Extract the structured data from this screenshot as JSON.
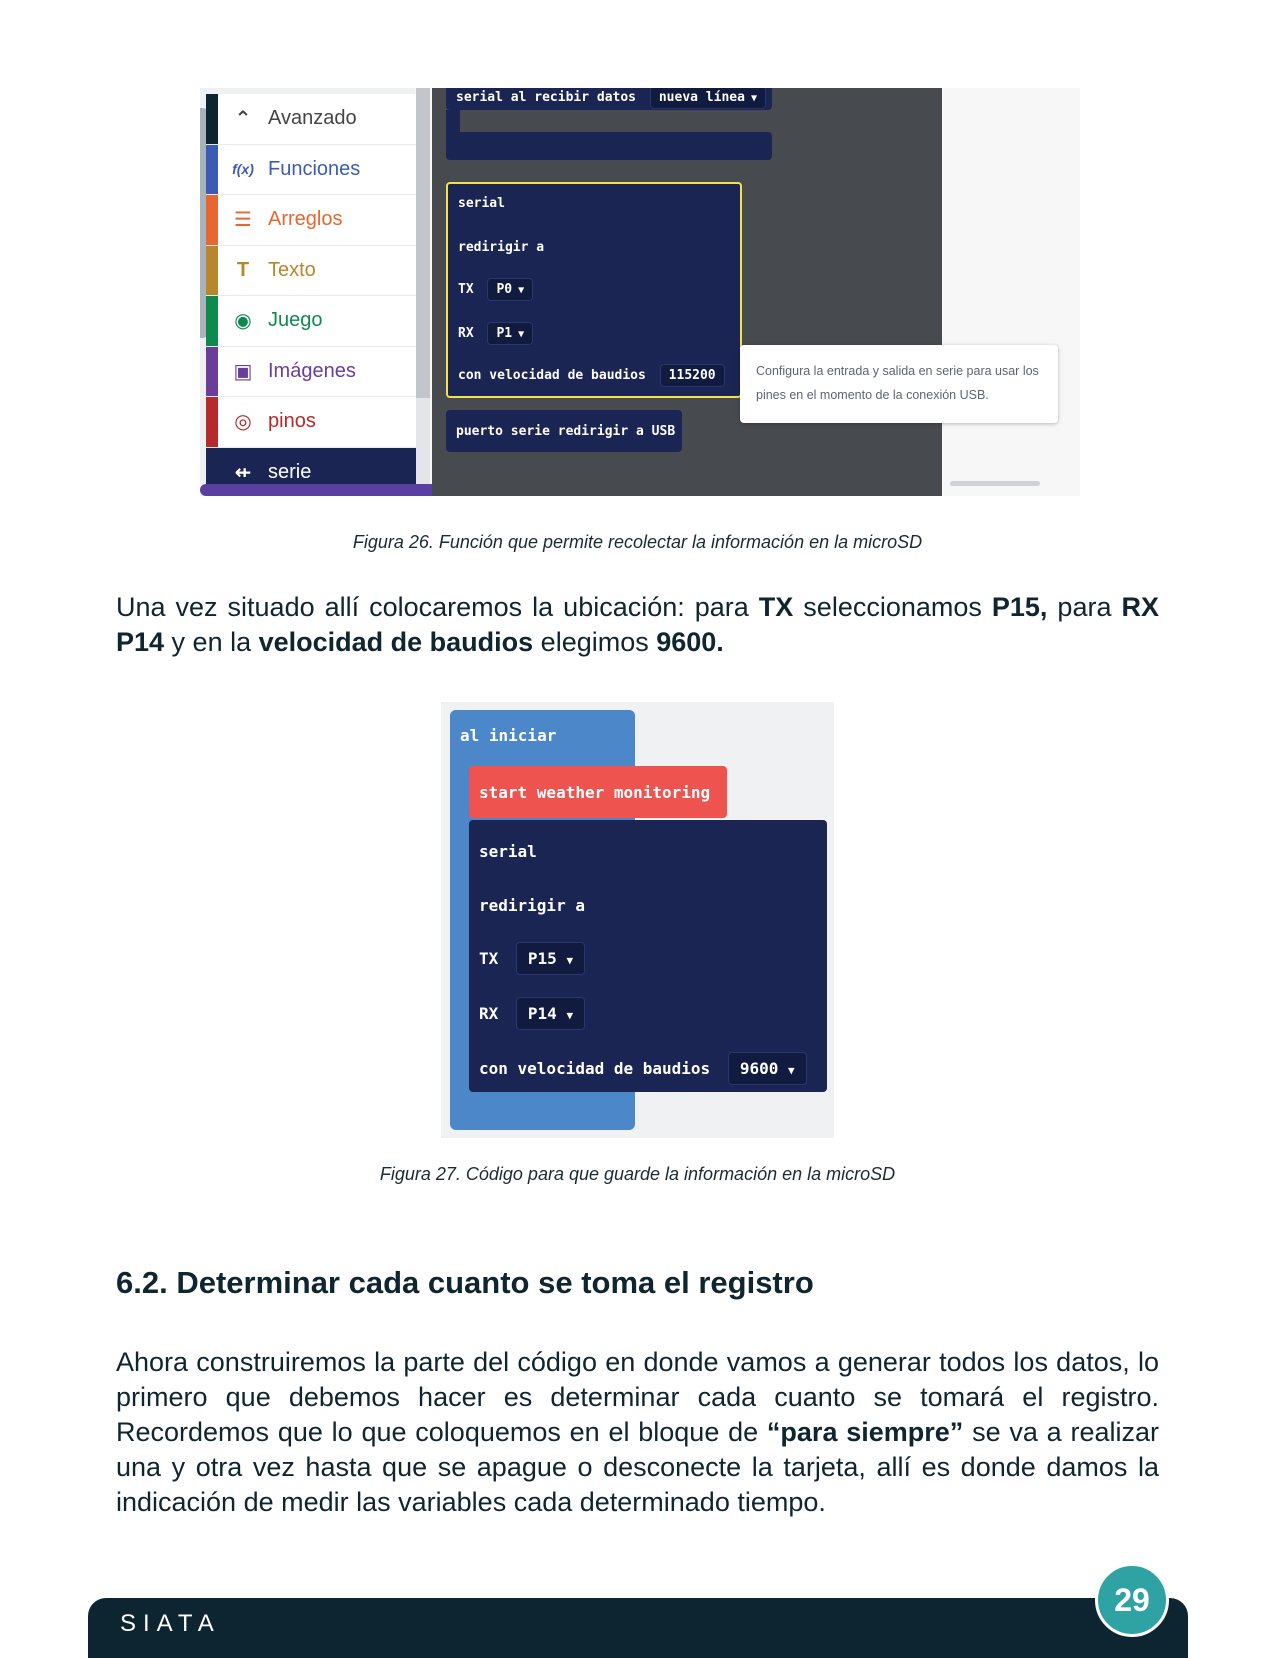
{
  "figure26": {
    "categories": [
      {
        "label": "Avanzado",
        "icon": "chevron-up-icon",
        "glyph": "⌃",
        "color": "#444444",
        "bar": "#0d2530"
      },
      {
        "label": "Funciones",
        "icon": "function-icon",
        "glyph": "f(x)",
        "color": "#3b5bb5",
        "bar": "#3b5bb5"
      },
      {
        "label": "Arreglos",
        "icon": "list-icon",
        "glyph": "☰",
        "color": "#e8662f",
        "bar": "#e8662f"
      },
      {
        "label": "Texto",
        "icon": "text-icon",
        "glyph": "T",
        "color": "#b8862c",
        "bar": "#b8862c"
      },
      {
        "label": "Juego",
        "icon": "gamepad-icon",
        "glyph": "◉",
        "color": "#0f8a4f",
        "bar": "#0f8a4f"
      },
      {
        "label": "Imágenes",
        "icon": "image-icon",
        "glyph": "▣",
        "color": "#6a3d9a",
        "bar": "#6a3d9a"
      },
      {
        "label": "pinos",
        "icon": "target-icon",
        "glyph": "◎",
        "color": "#b52a2a",
        "bar": "#b52a2a"
      },
      {
        "label": "serie",
        "icon": "usb-icon",
        "glyph": "⇷",
        "color": "#ffffff",
        "bar": "#1a2553"
      }
    ],
    "block_top": "serial al recibir datos",
    "block_top_dropdown": "nueva línea",
    "serial_label": "serial",
    "redirect_label": "redirigir a",
    "tx_label": "TX",
    "tx_value": "P0",
    "rx_label": "RX",
    "rx_value": "P1",
    "baud_label": "con velocidad de baudios",
    "baud_value": "115200",
    "usb_block": "puerto serie redirigir a USB",
    "tooltip": "Configura la entrada y salida en serie para usar los pines en el momento de la conexión USB."
  },
  "caption26": "Figura 26. Función que permite recolectar la información en la microSD",
  "paragraph1": {
    "t1": "Una vez situado allí colocaremos la ubicación: para ",
    "b1": "TX",
    "t2": " seleccionamos ",
    "b2": "P15,",
    "t3": " para ",
    "b3": "RX P14",
    "t4": " y en la ",
    "b4": "velocidad de baudios",
    "t5": " elegimos ",
    "b5": "9600."
  },
  "figure27": {
    "on_start": "al iniciar",
    "weather": "start weather monitoring",
    "serial_label": "serial",
    "redirect_label": "redirigir a",
    "tx_label": "TX",
    "tx_value": "P15",
    "rx_label": "RX",
    "rx_value": "P14",
    "baud_label": "con velocidad de baudios",
    "baud_value": "9600"
  },
  "caption27": "Figura 27. Código para que guarde la información en la microSD",
  "section_heading": "6.2. Determinar cada cuanto se toma el registro",
  "paragraph2": {
    "t1": "Ahora construiremos la parte del código en donde vamos a generar todos los datos, lo primero que debemos hacer es determinar cada cuanto se tomará el registro. Recordemos que lo que coloquemos en el bloque de ",
    "b1": "“para siempre”",
    "t2": " se va a realizar una y otra vez hasta que se apague o desconecte la tarjeta, allí es donde damos la indicación de medir las variables cada determinado tiempo."
  },
  "footer": {
    "brand": "SIATA",
    "page": "29"
  },
  "colors": {
    "footer": "#0d2530",
    "page_badge": "#2fa3a3",
    "block_navy": "#1a2553",
    "block_blue": "#4c88c9",
    "block_red": "#ef5350"
  }
}
